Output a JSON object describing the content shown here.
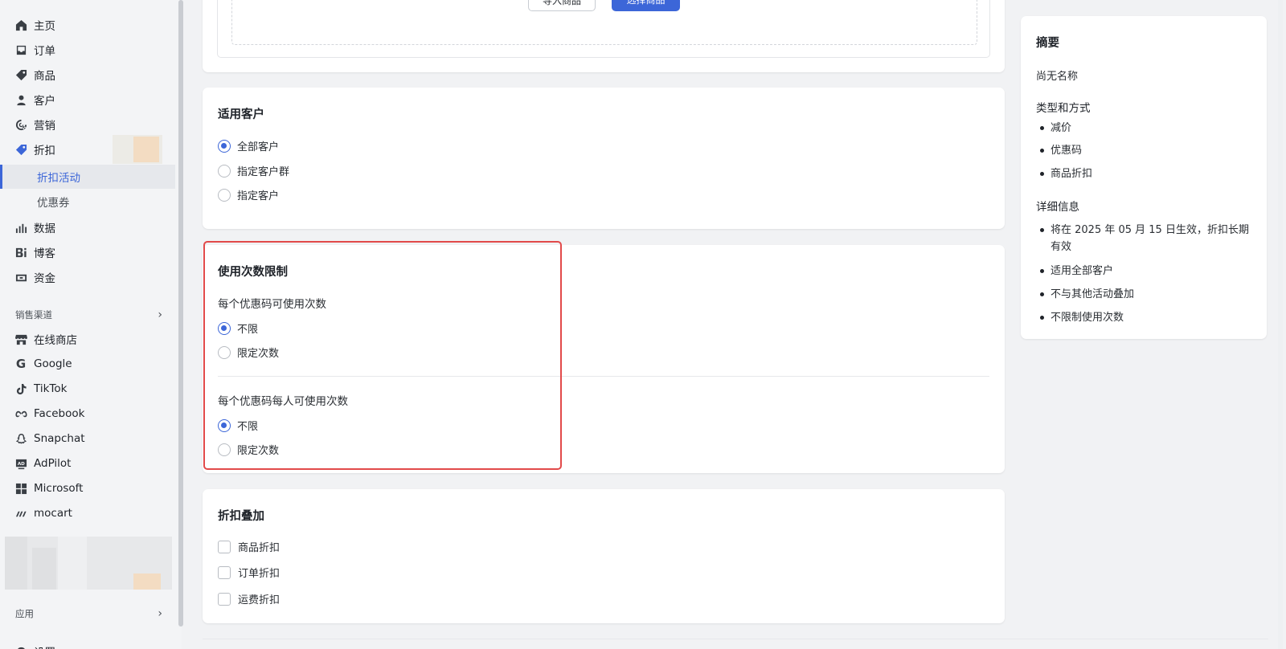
{
  "sidebar": {
    "items": [
      {
        "label": "主页",
        "icon": "home-icon"
      },
      {
        "label": "订单",
        "icon": "inbox-icon"
      },
      {
        "label": "商品",
        "icon": "tag-icon"
      },
      {
        "label": "客户",
        "icon": "person-icon"
      },
      {
        "label": "营销",
        "icon": "target-icon"
      },
      {
        "label": "折扣",
        "icon": "discount-tag-icon"
      },
      {
        "label": "数据",
        "icon": "bar-chart-icon"
      },
      {
        "label": "博客",
        "icon": "blog-icon"
      },
      {
        "label": "资金",
        "icon": "wallet-icon"
      }
    ],
    "discount_sub": [
      "折扣活动",
      "优惠券"
    ],
    "sales_channels_label": "销售渠道",
    "channels": [
      {
        "label": "在线商店",
        "icon": "store-icon"
      },
      {
        "label": "Google",
        "icon": "google-icon"
      },
      {
        "label": "TikTok",
        "icon": "tiktok-icon"
      },
      {
        "label": "Facebook",
        "icon": "meta-icon"
      },
      {
        "label": "Snapchat",
        "icon": "ghost-icon"
      },
      {
        "label": "AdPilot",
        "icon": "ad-icon"
      },
      {
        "label": "Microsoft",
        "icon": "windows-icon"
      },
      {
        "label": "mocart",
        "icon": "mocart-icon"
      }
    ],
    "apps_label": "应用",
    "settings_label": "设置"
  },
  "top_card": {
    "btn_outline": "导入商品",
    "btn_primary": "选择商品"
  },
  "customers_card": {
    "title": "适用客户",
    "options": [
      "全部客户",
      "指定客户群",
      "指定客户"
    ],
    "selected": 0
  },
  "usage_card": {
    "title": "使用次数限制",
    "group1_label": "每个优惠码可使用次数",
    "group1_options": [
      "不限",
      "限定次数"
    ],
    "group2_label": "每个优惠码每人可使用次数",
    "group2_options": [
      "不限",
      "限定次数"
    ]
  },
  "stacking_card": {
    "title": "折扣叠加",
    "options": [
      "商品折扣",
      "订单折扣",
      "运费折扣"
    ]
  },
  "summary": {
    "title": "摘要",
    "name": "尚无名称",
    "type_heading": "类型和方式",
    "type_items": [
      "减价",
      "优惠码",
      "商品折扣"
    ],
    "detail_heading": "详细信息",
    "detail_items": [
      "将在 2025 年 05 月 15 日生效，折扣长期有效",
      "适用全部客户",
      "不与其他活动叠加",
      "不限制使用次数"
    ]
  },
  "colors": {
    "accent": "#3c66d8",
    "highlight": "#e24a4a"
  }
}
